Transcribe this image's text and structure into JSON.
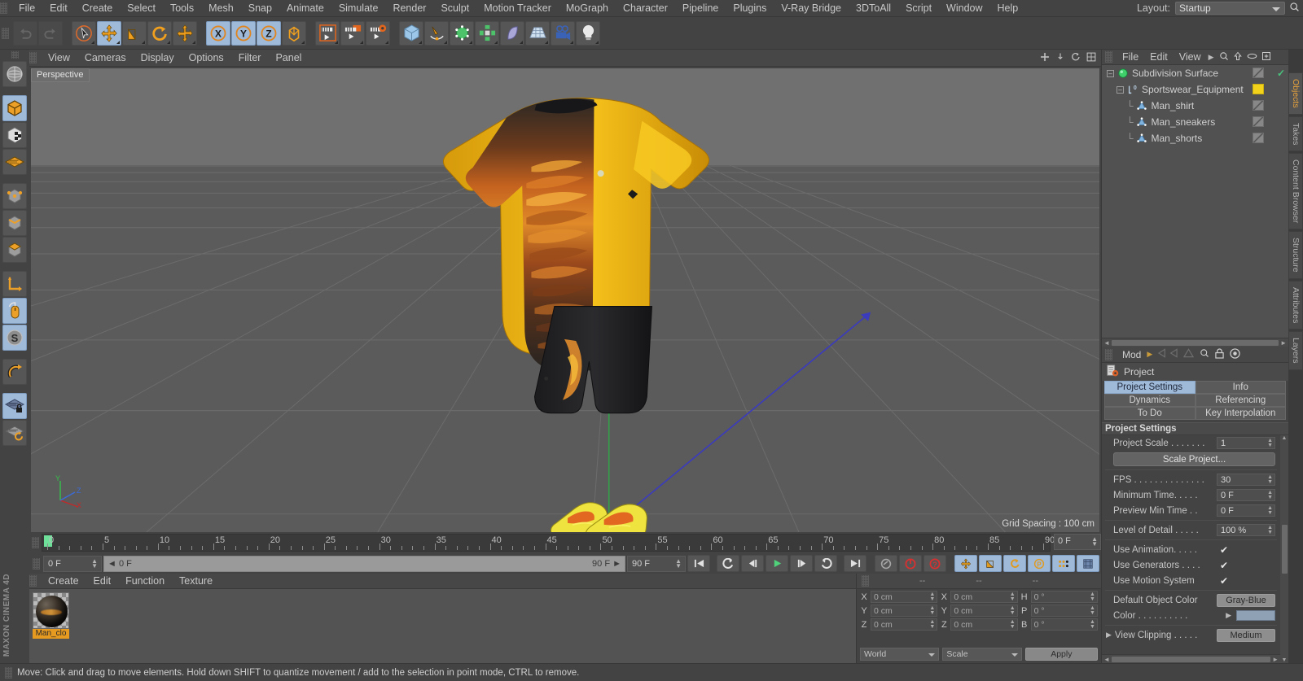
{
  "app": {
    "name": "MAXON CINEMA 4D"
  },
  "menubar": {
    "items": [
      "File",
      "Edit",
      "Create",
      "Select",
      "Tools",
      "Mesh",
      "Snap",
      "Animate",
      "Simulate",
      "Render",
      "Sculpt",
      "Motion Tracker",
      "MoGraph",
      "Character",
      "Pipeline",
      "Plugins",
      "V-Ray Bridge",
      "3DToAll",
      "Script",
      "Window",
      "Help"
    ],
    "layout_label": "Layout:",
    "layout_value": "Startup"
  },
  "toolbar": {
    "groups": [
      {
        "name": "history",
        "buttons": [
          {
            "name": "undo-button",
            "icon": "undo-icon",
            "state": "disabled"
          },
          {
            "name": "redo-button",
            "icon": "redo-icon",
            "state": "disabled"
          }
        ]
      },
      {
        "name": "transform",
        "buttons": [
          {
            "name": "select-tool-button",
            "icon": "cursor-icon",
            "state": "normal"
          },
          {
            "name": "move-tool-button",
            "icon": "move-icon",
            "state": "selected"
          },
          {
            "name": "scale-tool-button",
            "icon": "scale-icon",
            "state": "normal"
          },
          {
            "name": "rotate-tool-button",
            "icon": "rotate-icon",
            "state": "normal"
          },
          {
            "name": "move-alt-button",
            "icon": "move-icon",
            "state": "normal"
          }
        ]
      },
      {
        "name": "axis-lock",
        "buttons": [
          {
            "name": "axis-x-button",
            "icon": "x-axis-icon",
            "state": "selected"
          },
          {
            "name": "axis-y-button",
            "icon": "y-axis-icon",
            "state": "selected"
          },
          {
            "name": "axis-z-button",
            "icon": "z-axis-icon",
            "state": "selected"
          },
          {
            "name": "world-coord-button",
            "icon": "world-axis-icon",
            "state": "normal"
          }
        ]
      },
      {
        "name": "render",
        "buttons": [
          {
            "name": "render-view-button",
            "icon": "render-view-icon",
            "state": "normal"
          },
          {
            "name": "render-region-button",
            "icon": "render-region-icon",
            "state": "normal"
          },
          {
            "name": "render-settings-button",
            "icon": "render-settings-icon",
            "state": "normal"
          }
        ]
      },
      {
        "name": "create",
        "buttons": [
          {
            "name": "add-cube-button",
            "icon": "cube-icon",
            "state": "normal"
          },
          {
            "name": "add-spline-button",
            "icon": "pen-spline-icon",
            "state": "normal"
          },
          {
            "name": "add-nurbs-button",
            "icon": "green-cube-icon",
            "state": "normal"
          },
          {
            "name": "add-array-button",
            "icon": "array-icon",
            "state": "normal"
          },
          {
            "name": "add-deformer-button",
            "icon": "bend-deformer-icon",
            "state": "normal"
          },
          {
            "name": "add-floor-button",
            "icon": "floor-grid-icon",
            "state": "normal"
          },
          {
            "name": "add-camera-button",
            "icon": "camera-icon",
            "state": "normal"
          },
          {
            "name": "add-light-button",
            "icon": "light-bulb-icon",
            "state": "normal"
          }
        ]
      }
    ]
  },
  "left_toolbar": {
    "buttons": [
      {
        "name": "texture-axis-button",
        "icon": "globe-texture-icon",
        "state": "normal"
      },
      {
        "name": "model-mode-button",
        "icon": "orange-cube-icon",
        "state": "selected"
      },
      {
        "name": "texture-mode-button",
        "icon": "checker-cube-icon",
        "state": "normal"
      },
      {
        "name": "deformer-mode-button",
        "icon": "orange-grid-icon",
        "state": "normal"
      },
      {
        "name": "point-mode-button",
        "icon": "point-cube-icon",
        "state": "normal"
      },
      {
        "name": "edge-mode-button",
        "icon": "edge-cube-icon",
        "state": "normal"
      },
      {
        "name": "polygon-mode-button",
        "icon": "polygon-cube-icon",
        "state": "normal"
      },
      {
        "name": "axis-mode-button",
        "icon": "axis-arrow-icon",
        "state": "normal"
      },
      {
        "name": "viewport-solo-button",
        "icon": "mouse-icon",
        "state": "selected"
      },
      {
        "name": "scale-snap-button",
        "icon": "s-circle-icon",
        "state": "selected"
      },
      {
        "name": "magnet-button",
        "icon": "magnet-icon",
        "state": "normal"
      },
      {
        "name": "workplane-lock-button",
        "icon": "grid-lock-icon",
        "state": "selected"
      },
      {
        "name": "workplane-rotate-button",
        "icon": "grid-rotate-icon",
        "state": "normal"
      }
    ]
  },
  "viewport": {
    "menu": [
      "View",
      "Cameras",
      "Display",
      "Options",
      "Filter",
      "Panel"
    ],
    "label": "Perspective",
    "grid_spacing": "Grid Spacing : 100 cm",
    "axis_labels": {
      "x": "X",
      "y": "Y",
      "z": "Z"
    }
  },
  "timeline": {
    "ticks": [
      0,
      5,
      10,
      15,
      20,
      25,
      30,
      35,
      40,
      45,
      50,
      55,
      60,
      65,
      70,
      75,
      80,
      85,
      90
    ],
    "current_frame_field": "0 F",
    "playhead_frame": 0
  },
  "playback": {
    "start_field": "0 F",
    "scrub_value": "0 F",
    "scrub_end": "90 F",
    "end_field": "90 F",
    "buttons": [
      {
        "name": "go-to-start-button",
        "icon": "skip-start-icon",
        "state": "normal"
      },
      {
        "name": "step-back-keyframe-button",
        "icon": "prev-key-icon",
        "state": "normal"
      },
      {
        "name": "step-back-frame-button",
        "icon": "step-back-icon",
        "state": "normal"
      },
      {
        "name": "play-button",
        "icon": "play-icon",
        "state": "normal"
      },
      {
        "name": "step-forward-frame-button",
        "icon": "step-forward-icon",
        "state": "normal"
      },
      {
        "name": "step-forward-keyframe-button",
        "icon": "next-key-icon",
        "state": "normal"
      },
      {
        "name": "go-to-end-button",
        "icon": "skip-end-icon",
        "state": "normal"
      },
      {
        "name": "record-active-objects-button",
        "icon": "key-icon",
        "state": "disabled"
      },
      {
        "name": "autokeying-button",
        "icon": "record-red-icon",
        "state": "normal"
      },
      {
        "name": "keyframe-selection-button",
        "icon": "question-red-icon",
        "state": "normal"
      },
      {
        "name": "position-key-button",
        "icon": "move-key-icon",
        "state": "selected"
      },
      {
        "name": "scale-key-button",
        "icon": "scale-key-icon",
        "state": "selected"
      },
      {
        "name": "rotation-key-button",
        "icon": "rotate-key-icon",
        "state": "selected"
      },
      {
        "name": "parameter-key-button",
        "icon": "param-key-icon",
        "state": "selected"
      },
      {
        "name": "pla-key-button",
        "icon": "pla-dots-icon",
        "state": "selected"
      },
      {
        "name": "timeline-toggle-button",
        "icon": "timeline-icon",
        "state": "selected"
      }
    ]
  },
  "materials": {
    "menu": [
      "Create",
      "Edit",
      "Function",
      "Texture"
    ],
    "items": [
      {
        "name": "Man_clo",
        "icon": "material-sphere-icon"
      }
    ]
  },
  "coordinates": {
    "headers": [
      "--",
      "--",
      "--"
    ],
    "rows": [
      {
        "pos_label": "X",
        "pos_value": "0 cm",
        "size_label": "X",
        "size_value": "0 cm",
        "rot_label": "H",
        "rot_value": "0 °"
      },
      {
        "pos_label": "Y",
        "pos_value": "0 cm",
        "size_label": "Y",
        "size_value": "0 cm",
        "rot_label": "P",
        "rot_value": "0 °"
      },
      {
        "pos_label": "Z",
        "pos_value": "0 cm",
        "size_label": "Z",
        "size_value": "0 cm",
        "rot_label": "B",
        "rot_value": "0 °"
      }
    ],
    "system": "World",
    "mode": "Scale",
    "apply": "Apply"
  },
  "object_manager": {
    "menu": [
      "File",
      "Edit",
      "View"
    ],
    "items": [
      {
        "label": "Subdivision Surface",
        "icon": "subdivision-surface-icon",
        "indent": 0,
        "expanded": true,
        "tag": "grey",
        "check": true
      },
      {
        "label": "Sportswear_Equipment",
        "icon": "layer-null-icon",
        "indent": 1,
        "expanded": true,
        "tag": "yellow",
        "check": false
      },
      {
        "label": "Man_shirt",
        "icon": "polygon-object-icon",
        "indent": 2,
        "expanded": false,
        "tag": "grey",
        "check": false
      },
      {
        "label": "Man_sneakers",
        "icon": "polygon-object-icon",
        "indent": 2,
        "expanded": false,
        "tag": "grey",
        "check": false
      },
      {
        "label": "Man_shorts",
        "icon": "polygon-object-icon",
        "indent": 2,
        "expanded": false,
        "tag": "grey",
        "check": false
      }
    ]
  },
  "attributes": {
    "mode_label": "Mod",
    "object_title": "Project",
    "tabs": [
      {
        "label": "Project Settings",
        "selected": true
      },
      {
        "label": "Info",
        "selected": false
      },
      {
        "label": "Dynamics",
        "selected": false
      },
      {
        "label": "Referencing",
        "selected": false
      },
      {
        "label": "To Do",
        "selected": false
      },
      {
        "label": "Key Interpolation",
        "selected": false
      }
    ],
    "section_title": "Project Settings",
    "fields": [
      {
        "label": "Project Scale . . . . . . .",
        "value": "1",
        "kind": "spinner"
      },
      {
        "label": "Scale Project...",
        "value": "",
        "kind": "button"
      },
      {
        "label": "FPS . . . . . . . . . . . . . .",
        "value": "30",
        "kind": "spinner"
      },
      {
        "label": "Minimum Time. . . . .",
        "value": "0 F",
        "kind": "spinner"
      },
      {
        "label": "Preview Min Time . .",
        "value": "0 F",
        "kind": "spinner"
      },
      {
        "label": "Level of Detail . . . . .",
        "value": "100 %",
        "kind": "spinner"
      },
      {
        "label": "Use Animation. . . . .",
        "value": "✔",
        "kind": "check"
      },
      {
        "label": "Use Generators . . . .",
        "value": "✔",
        "kind": "check"
      },
      {
        "label": "Use Motion System",
        "value": "✔",
        "kind": "check"
      },
      {
        "label": "Default Object Color",
        "value": "Gray-Blue",
        "kind": "dropbtn"
      },
      {
        "label": "Color . . . . . . . . . .",
        "value": "",
        "kind": "color"
      },
      {
        "label": "View Clipping . . . . .",
        "value": "Medium",
        "kind": "dropbtn"
      }
    ],
    "color_value": "#8fa2b5"
  },
  "right_tabs": [
    {
      "label": "Objects",
      "selected": true
    },
    {
      "label": "Takes",
      "selected": false
    },
    {
      "label": "Content Browser",
      "selected": false
    },
    {
      "label": "Structure",
      "selected": false
    },
    {
      "label": "Attributes",
      "selected": false
    },
    {
      "label": "Layers",
      "selected": false
    }
  ],
  "status": {
    "message": "Move: Click and drag to move elements. Hold down SHIFT to quantize movement / add to the selection in point mode, CTRL to remove."
  }
}
